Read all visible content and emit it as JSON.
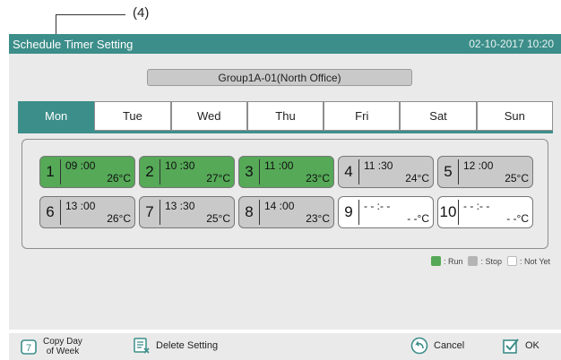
{
  "callout": "(4)",
  "title": "Schedule Timer Setting",
  "datetime": "02-10-2017  10:20",
  "group": "Group1A-01(North Office)",
  "tabs": [
    {
      "label": "Mon",
      "active": true
    },
    {
      "label": "Tue"
    },
    {
      "label": "Wed"
    },
    {
      "label": "Thu"
    },
    {
      "label": "Fri"
    },
    {
      "label": "Sat"
    },
    {
      "label": "Sun"
    }
  ],
  "slots": [
    {
      "num": "1",
      "time": "09 :00",
      "temp": "26°C",
      "state": "run"
    },
    {
      "num": "2",
      "time": "10 :30",
      "temp": "27°C",
      "state": "run"
    },
    {
      "num": "3",
      "time": "11 :00",
      "temp": "23°C",
      "state": "run"
    },
    {
      "num": "4",
      "time": "11 :30",
      "temp": "24°C",
      "state": "stop"
    },
    {
      "num": "5",
      "time": "12 :00",
      "temp": "25°C",
      "state": "stop"
    },
    {
      "num": "6",
      "time": "13 :00",
      "temp": "26°C",
      "state": "stop"
    },
    {
      "num": "7",
      "time": "13 :30",
      "temp": "25°C",
      "state": "stop"
    },
    {
      "num": "8",
      "time": "14 :00",
      "temp": "23°C",
      "state": "stop"
    },
    {
      "num": "9",
      "time": "- - :- -",
      "temp": "- -°C",
      "state": "notyet"
    },
    {
      "num": "10",
      "time": "- - :- -",
      "temp": "- -°C",
      "state": "notyet"
    }
  ],
  "legend": {
    "run": ": Run",
    "stop": ": Stop",
    "notyet": ": Not Yet"
  },
  "buttons": {
    "copy_line1": "Copy Day",
    "copy_line2": "of Week",
    "delete": "Delete Setting",
    "cancel": "Cancel",
    "ok": "OK"
  },
  "colors": {
    "accent": "#3c8e8a",
    "run": "#55a957",
    "stop": "#c9c9c9",
    "notyet": "#ffffff"
  }
}
